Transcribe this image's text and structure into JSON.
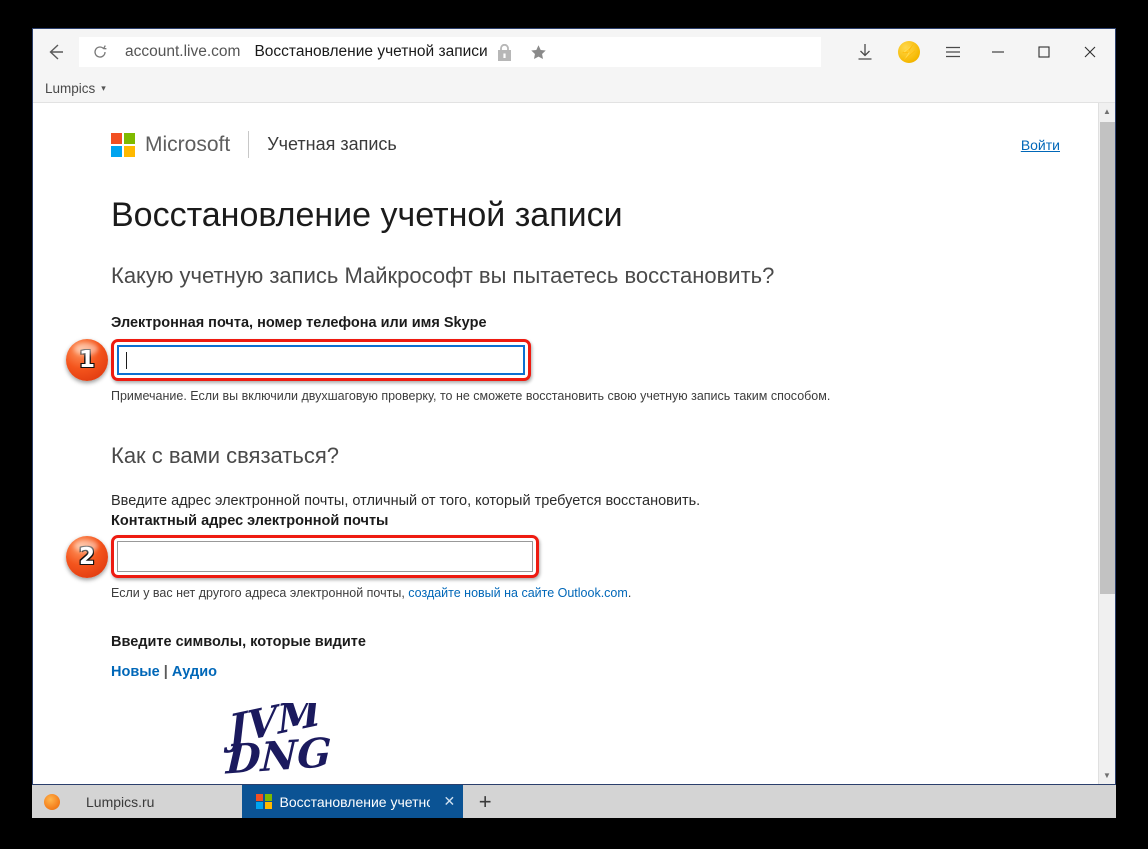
{
  "browser": {
    "back_label": "Back",
    "reload_label": "Reload",
    "url_domain": "account.live.com",
    "page_title_in_bar": "Восстановление учетной записи",
    "lock_icon": "lock-icon",
    "star_icon": "star-icon",
    "download_icon": "download-icon",
    "bolt_icon": "lightning-bolt-icon",
    "menu_icon": "hamburger-menu-icon",
    "minimize_label": "—",
    "maximize_label": "▢",
    "close_label": "✕",
    "bookmark": {
      "label": "Lumpics",
      "caret": "▾"
    }
  },
  "header": {
    "brand": "Microsoft",
    "divider": "|",
    "subtitle": "Учетная запись",
    "signin": "Войти",
    "colors": {
      "red": "#f25022",
      "green": "#7fba00",
      "blue": "#00a4ef",
      "yellow": "#ffb900",
      "link": "#0067b8"
    }
  },
  "page": {
    "title": "Восстановление учетной записи",
    "section1": {
      "heading": "Какую учетную запись Майкрософт вы пытаетесь восстановить?",
      "field_label": "Электронная почта, номер телефона или имя Skype",
      "field_value": "",
      "badge": "1",
      "note": "Примечание. Если вы включили двухшаговую проверку, то не сможете восстановить свою учетную запись таким способом."
    },
    "section2": {
      "heading": "Как с вами связаться?",
      "description": "Введите адрес электронной почты, отличный от того, который требуется восстановить.",
      "field_label": "Контактный адрес электронной почты",
      "field_value": "",
      "badge": "2",
      "note_prefix": "Если у вас нет другого адреса электронной почты, ",
      "note_link": "создайте новый на сайте Outlook.com",
      "note_suffix": "."
    },
    "captcha": {
      "label": "Введите символы, которые видите",
      "link_new": "Новые",
      "separator": "|",
      "link_audio": "Аудио",
      "image_text": "JVM DNG"
    }
  },
  "tabbar": {
    "site_icon": "orange-site-icon",
    "inactive_tab": "Lumpics.ru",
    "active_tab": "Восстановление учетной",
    "close": "✕",
    "new_tab": "+"
  },
  "scrollbar": {
    "up": "▲",
    "down": "▼"
  }
}
